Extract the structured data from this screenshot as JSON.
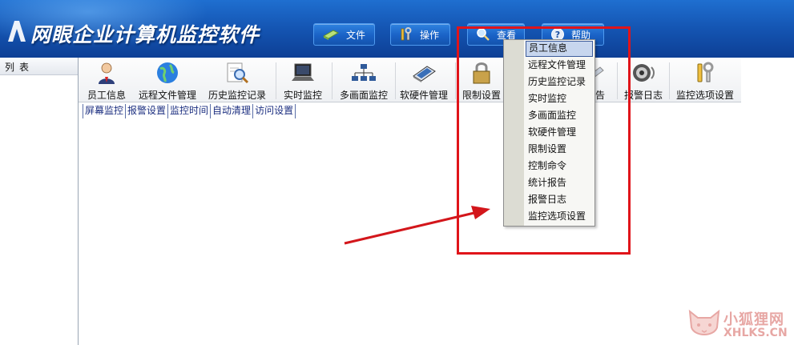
{
  "banner": {
    "title": "网眼企业计算机监控软件",
    "buttons": [
      {
        "label": "文件",
        "icon": "file-icon"
      },
      {
        "label": "操作",
        "icon": "tools-icon"
      },
      {
        "label": "查看",
        "icon": "magnifier-icon"
      },
      {
        "label": "帮助",
        "icon": "help-icon"
      }
    ]
  },
  "left_panel": {
    "header": "列表"
  },
  "toolbar": {
    "items": [
      {
        "label": "员工信息",
        "icon": "employee-icon"
      },
      {
        "label": "远程文件管理",
        "icon": "globe-icon"
      },
      {
        "label": "历史监控记录",
        "icon": "history-search-icon"
      },
      {
        "label": "实时监控",
        "icon": "laptop-icon"
      },
      {
        "label": "多画面监控",
        "icon": "network-icon"
      },
      {
        "label": "软硬件管理",
        "icon": "hardware-icon"
      },
      {
        "label": "限制设置",
        "icon": "lock-icon"
      },
      {
        "label": "报告",
        "icon": "report-icon"
      },
      {
        "label": "报警日志",
        "icon": "speaker-icon"
      },
      {
        "label": "监控选项设置",
        "icon": "options-tools-icon"
      }
    ]
  },
  "sublinks": [
    "屏幕监控",
    "报警设置",
    "监控时间",
    "自动清理",
    "访问设置"
  ],
  "view_menu": {
    "items": [
      "员工信息",
      "远程文件管理",
      "历史监控记录",
      "实时监控",
      "多画面监控",
      "软硬件管理",
      "限制设置",
      "控制命令",
      "统计报告",
      "报警日志",
      "监控选项设置"
    ],
    "highlighted_index": 0
  },
  "watermark": {
    "text": "小狐狸网",
    "sub": "XHLKS.CN"
  },
  "colors": {
    "banner": "#1557b5",
    "annotation_red": "#e0141a",
    "menu_highlight": "#c7d6ee"
  }
}
